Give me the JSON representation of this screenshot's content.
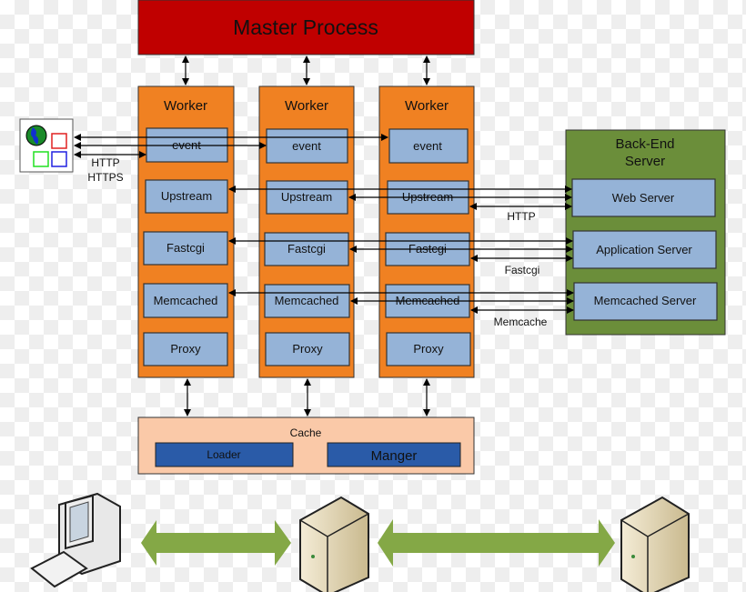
{
  "master": {
    "label": "Master Process",
    "color": "#C00000"
  },
  "workers": [
    {
      "title": "Worker",
      "modules": [
        "event",
        "Upstream",
        "Fastcgi",
        "Memcached",
        "Proxy"
      ]
    },
    {
      "title": "Worker",
      "modules": [
        "event",
        "Upstream",
        "Fastcgi",
        "Memcached",
        "Proxy"
      ]
    },
    {
      "title": "Worker",
      "modules": [
        "event",
        "Upstream",
        "Fastcgi",
        "Memcached",
        "Proxy"
      ]
    }
  ],
  "worker_color": "#F08122",
  "client": {
    "protocol_line1": "HTTP",
    "protocol_line2": "HTTPS",
    "icon": "globe-windows-icon"
  },
  "backend": {
    "title_line1": "Back-End",
    "title_line2": "Server",
    "color": "#6B8E3A",
    "servers": [
      "Web Server",
      "Application Server",
      "Memcached Server"
    ],
    "protocols": [
      "HTTP",
      "Fastcgi",
      "Memcache"
    ]
  },
  "cache": {
    "title": "Cache",
    "loader": "Loader",
    "manager": "Manger",
    "color": "#FAC9A8"
  },
  "bottom": {
    "icons": [
      "desktop-computer-icon",
      "server-tower-icon",
      "server-tower-icon"
    ],
    "arrow_color": "#84A846"
  }
}
